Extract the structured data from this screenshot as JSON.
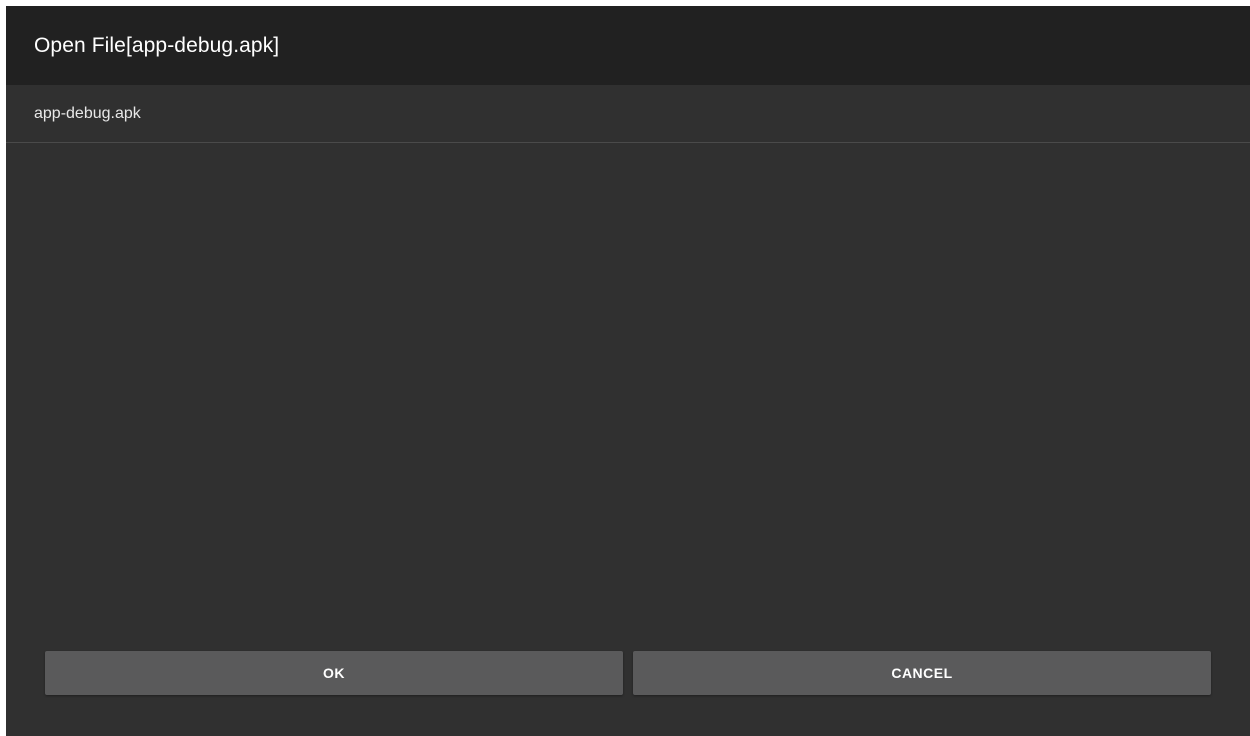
{
  "dialog": {
    "title": "Open File[app-debug.apk]",
    "file_item": "app-debug.apk",
    "ok_label": "OK",
    "cancel_label": "CANCEL"
  },
  "colors": {
    "title_bar_bg": "#212121",
    "dialog_bg": "#303030",
    "button_bg": "#5a5a5b",
    "text": "#ffffff"
  }
}
